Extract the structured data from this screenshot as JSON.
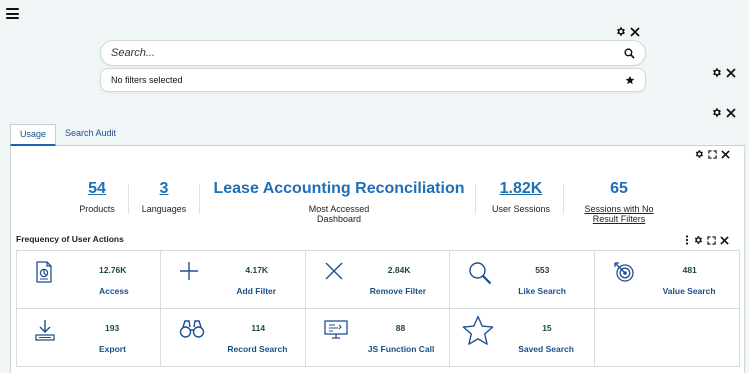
{
  "search": {
    "placeholder": "Search..."
  },
  "filters": {
    "status": "No filters selected"
  },
  "tabs": [
    {
      "label": "Usage",
      "active": true
    },
    {
      "label": "Search Audit",
      "active": false
    }
  ],
  "summary": [
    {
      "value": "54",
      "label": "Products",
      "value_link": true,
      "label_link": false
    },
    {
      "value": "3",
      "label": "Languages",
      "value_link": true,
      "label_link": false
    },
    {
      "value": "Lease Accounting Reconciliation",
      "label": "Most Accessed Dashboard",
      "value_link": false,
      "label_link": false
    },
    {
      "value": "1.82K",
      "label": "User Sessions",
      "value_link": true,
      "label_link": false
    },
    {
      "value": "65",
      "label": "Sessions with No Result Filters",
      "value_link": false,
      "label_link": true
    }
  ],
  "frequency": {
    "title": "Frequency of User Actions",
    "items": [
      {
        "value": "12.76K",
        "label": "Access",
        "icon": "document-chart-icon"
      },
      {
        "value": "4.17K",
        "label": "Add Filter",
        "icon": "plus-icon"
      },
      {
        "value": "2.84K",
        "label": "Remove Filter",
        "icon": "x-icon"
      },
      {
        "value": "553",
        "label": "Like Search",
        "icon": "magnifier-icon"
      },
      {
        "value": "481",
        "label": "Value Search",
        "icon": "target-icon"
      },
      {
        "value": "193",
        "label": "Export",
        "icon": "export-tray-icon"
      },
      {
        "value": "114",
        "label": "Record Search",
        "icon": "binoculars-icon"
      },
      {
        "value": "88",
        "label": "JS Function Call",
        "icon": "monitor-code-icon"
      },
      {
        "value": "15",
        "label": "Saved Search",
        "icon": "star-outline-icon"
      }
    ]
  },
  "colors": {
    "accent": "#1f6fb6",
    "value_green": "#1e4d2b",
    "link_blue": "#1a4f8a"
  }
}
